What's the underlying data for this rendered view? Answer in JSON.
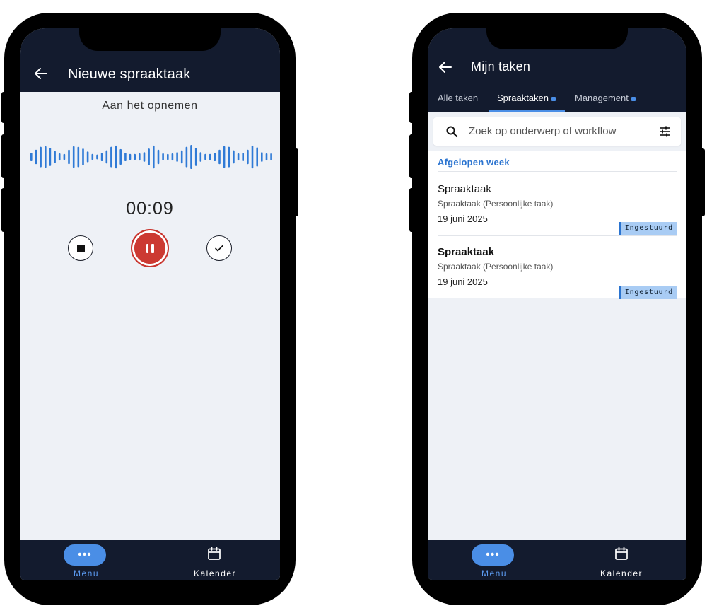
{
  "left_phone": {
    "title": "Nieuwe spraaktaak",
    "status": "Aan het opnemen",
    "timer": "00:09",
    "controls": {
      "stop": "stop-icon",
      "pause": "pause-icon",
      "done": "check-icon"
    },
    "nav": {
      "menu_label": "Menu",
      "menu_icon": "•••",
      "calendar_label": "Kalender"
    }
  },
  "right_phone": {
    "title": "Mijn taken",
    "tabs": [
      {
        "label": "Alle taken",
        "dot": false
      },
      {
        "label": "Spraaktaken",
        "dot": true,
        "active": true
      },
      {
        "label": "Management",
        "dot": true
      }
    ],
    "search": {
      "placeholder": "Zoek op onderwerp of workflow"
    },
    "section": "Afgelopen week",
    "items": [
      {
        "title": "Spraaktaak",
        "subtitle": "Spraaktaak (Persoonlijke taak)",
        "date": "19 juni 2025",
        "badge": "Ingestuurd",
        "bold": false
      },
      {
        "title": "Spraaktaak",
        "subtitle": "Spraaktaak (Persoonlijke taak)",
        "date": "19 juni 2025",
        "badge": "Ingestuurd",
        "bold": true
      }
    ],
    "nav": {
      "menu_label": "Menu",
      "menu_icon": "•••",
      "calendar_label": "Kalender"
    }
  },
  "colors": {
    "appbar": "#131b2e",
    "accent": "#4a8ee6",
    "record": "#cc3a32",
    "badge_bg": "#a9ccf4",
    "section": "#2b74d0"
  }
}
